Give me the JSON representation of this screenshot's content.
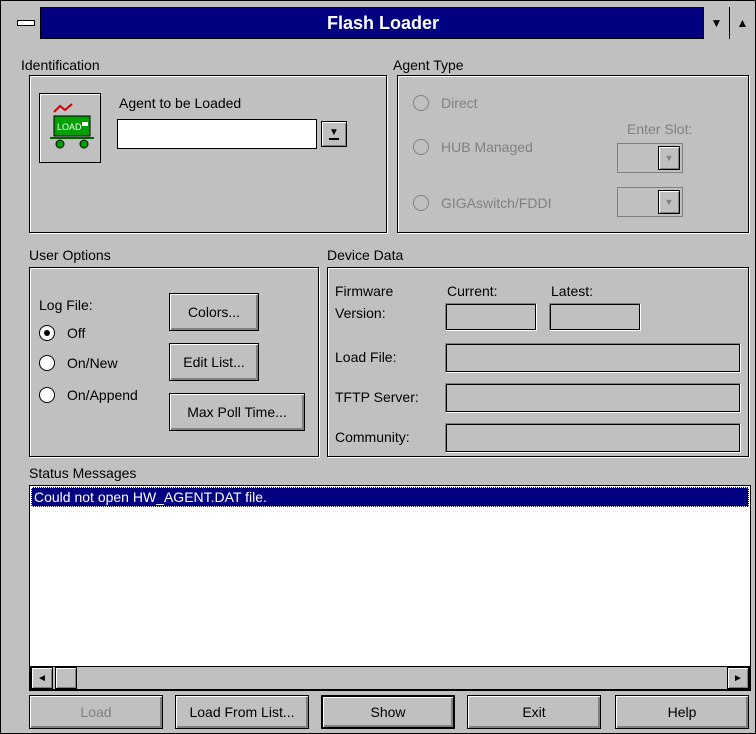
{
  "window": {
    "title": "Flash Loader"
  },
  "identification": {
    "label": "Identification",
    "agent_label": "Agent to be Loaded",
    "agent_value": "",
    "icon_text": "LOAD"
  },
  "agent_type": {
    "label": "Agent Type",
    "options": [
      "Direct",
      "HUB Managed",
      "GIGAswitch/FDDI"
    ],
    "enter_slot_label": "Enter Slot:"
  },
  "user_options": {
    "label": "User Options",
    "log_file_label": "Log File:",
    "log_options": [
      "Off",
      "On/New",
      "On/Append"
    ],
    "selected_log": "Off",
    "colors_button": "Colors...",
    "edit_list_button": "Edit List...",
    "max_poll_button": "Max Poll Time..."
  },
  "device_data": {
    "label": "Device Data",
    "firmware_label_1": "Firmware",
    "firmware_label_2": "Version:",
    "current_label": "Current:",
    "latest_label": "Latest:",
    "load_file_label": "Load File:",
    "tftp_label": "TFTP Server:",
    "community_label": "Community:"
  },
  "status": {
    "label": "Status Messages",
    "messages": [
      "Could not open HW_AGENT.DAT file."
    ]
  },
  "buttons": {
    "load": "Load",
    "load_from_list": "Load From List...",
    "show": "Show",
    "exit": "Exit",
    "help": "Help"
  },
  "icons": {
    "dropdown": "▼",
    "left_arrow": "◄",
    "right_arrow": "►",
    "minimize": "▼",
    "maximize": "▲"
  }
}
